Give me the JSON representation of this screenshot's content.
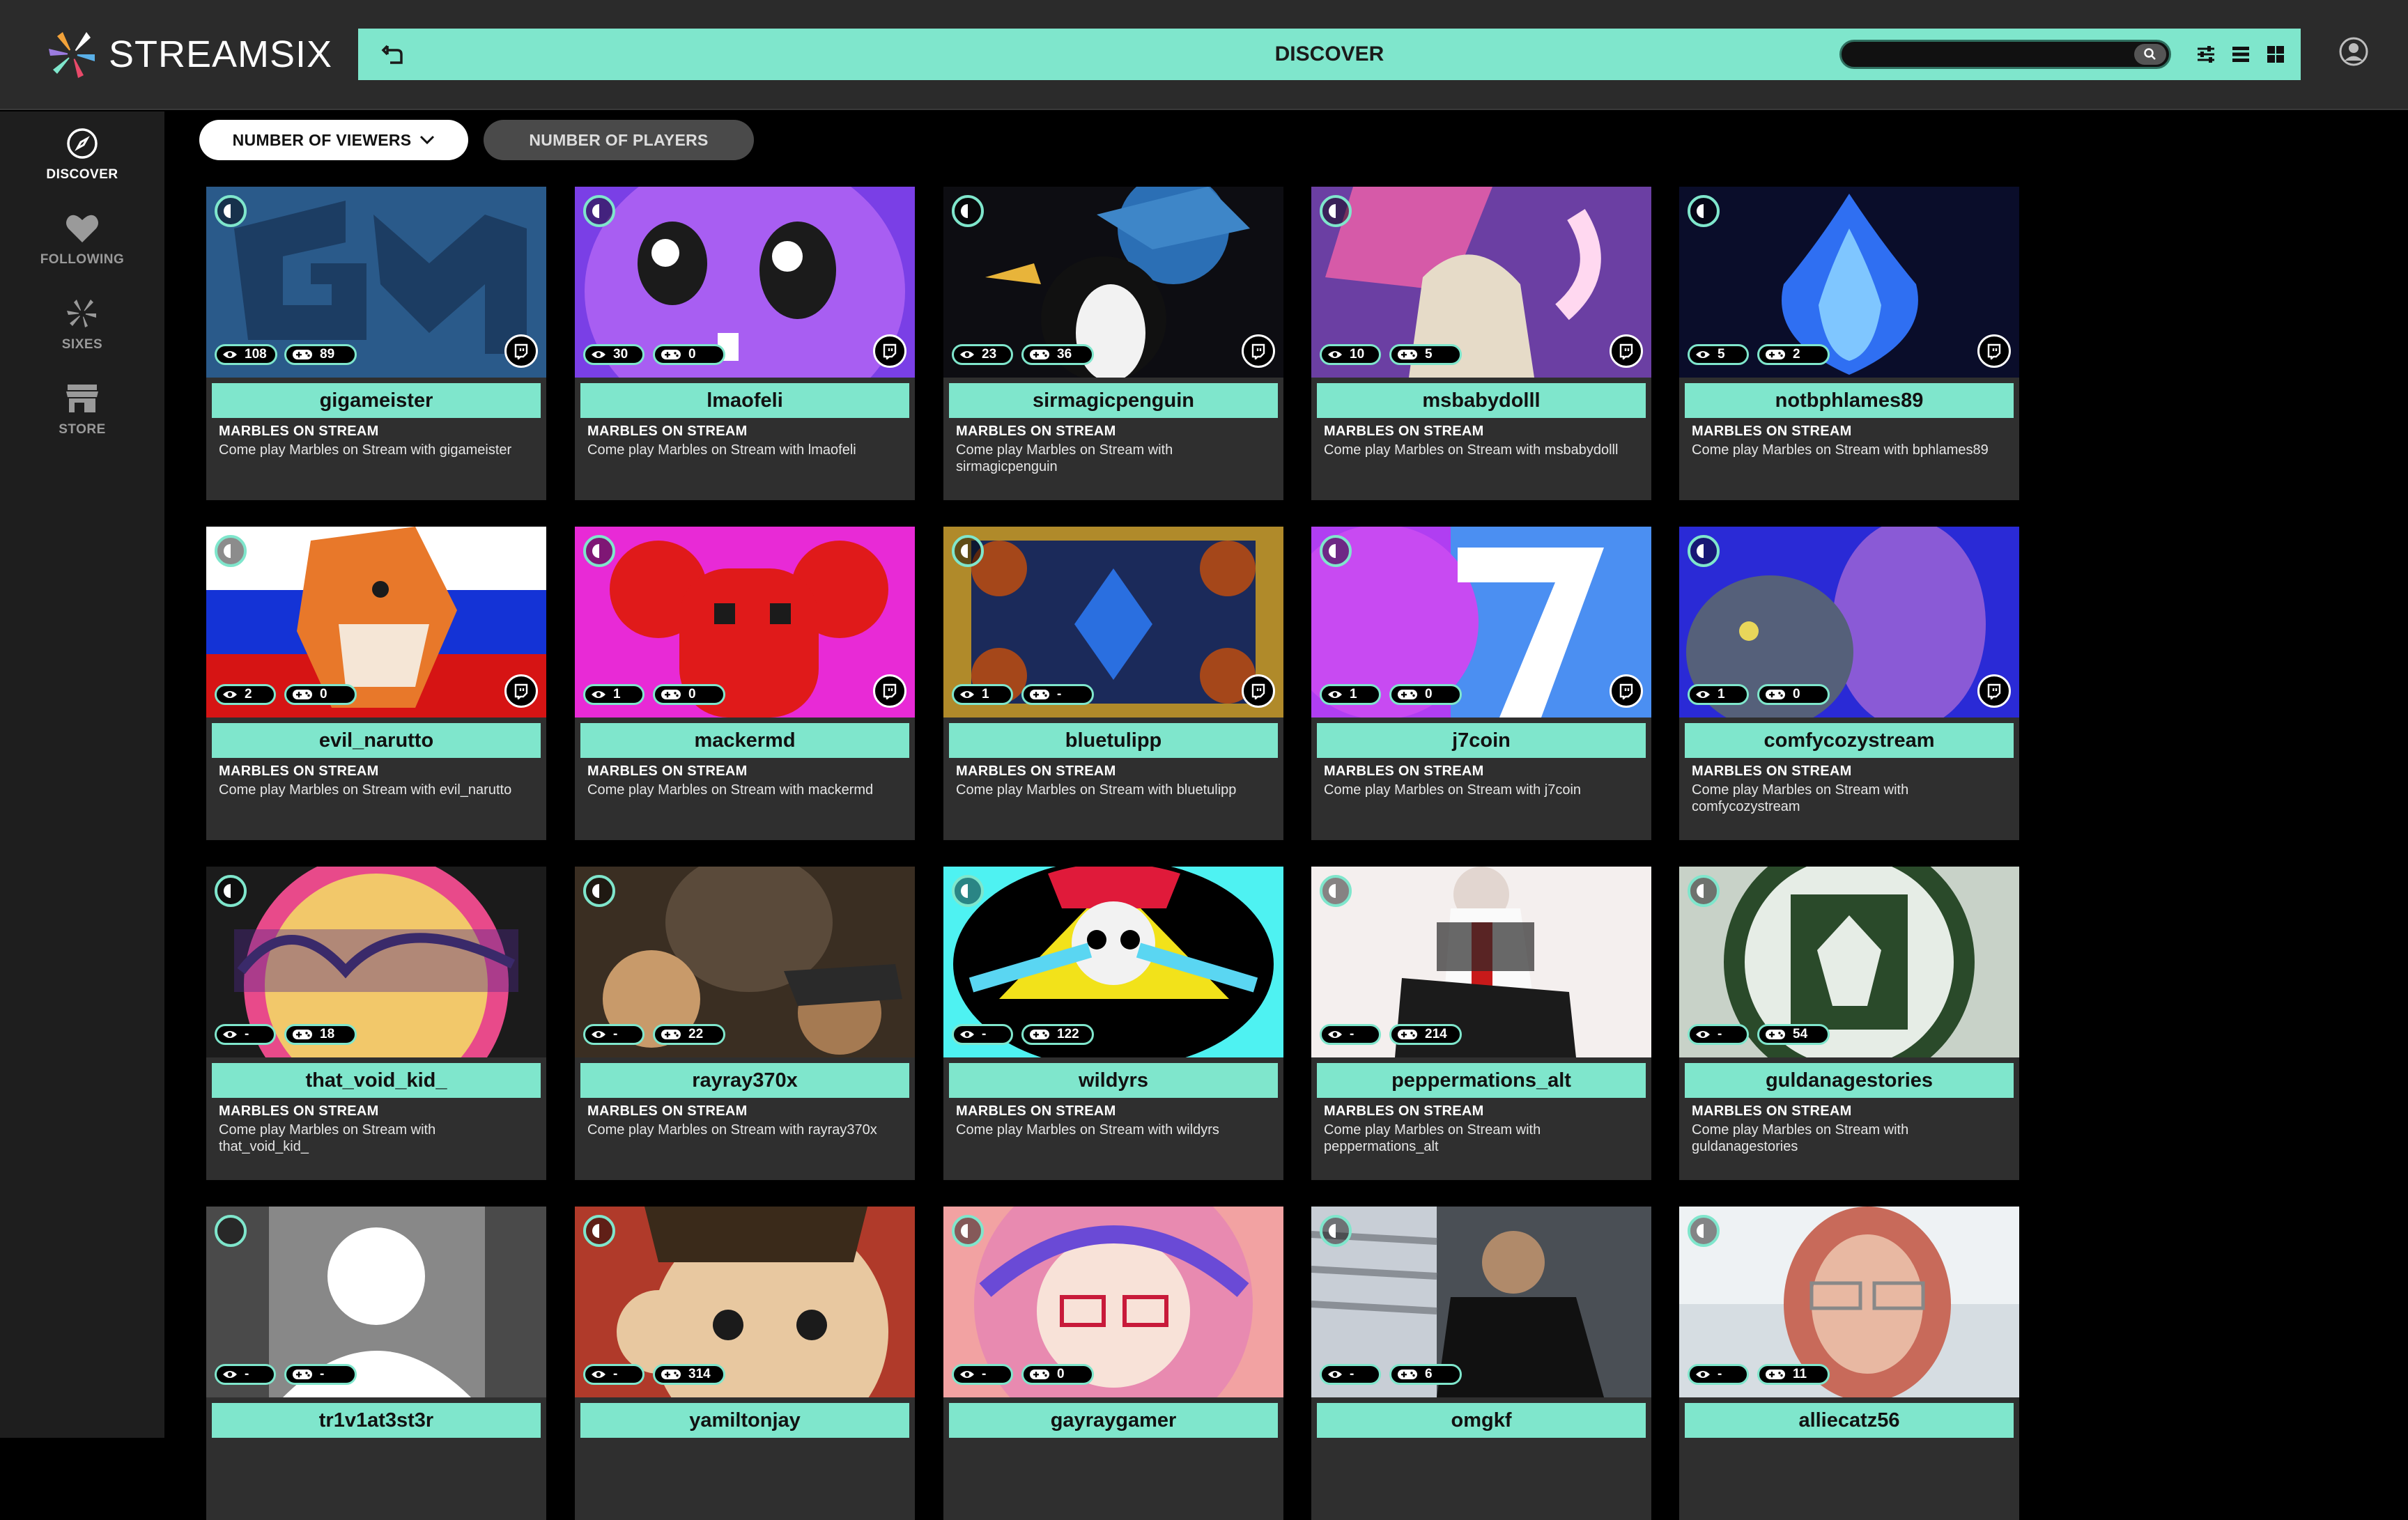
{
  "app": {
    "name": "STREAMSIX",
    "accent": "#7fe6cc"
  },
  "header": {
    "title": "DISCOVER",
    "search_value": "",
    "search_placeholder": "",
    "icons": [
      "back-icon",
      "search-icon",
      "filter-sliders-icon",
      "list-view-icon",
      "grid-view-icon",
      "profile-icon"
    ]
  },
  "sidebar": {
    "items": [
      {
        "label": "DISCOVER",
        "icon": "compass-icon",
        "active": true
      },
      {
        "label": "FOLLOWING",
        "icon": "heart-icon",
        "active": false
      },
      {
        "label": "SIXES",
        "icon": "sixes-icon",
        "active": false
      },
      {
        "label": "STORE",
        "icon": "store-icon",
        "active": false
      }
    ]
  },
  "filters": {
    "viewers_label": "NUMBER OF VIEWERS",
    "players_label": "NUMBER OF PLAYERS",
    "active": "viewers"
  },
  "cards": [
    {
      "name": "gigameister",
      "viewers": "108",
      "players": "89",
      "game": "MARBLES ON STREAM",
      "desc": "Come play Marbles on Stream with gigameister",
      "twitch": true,
      "live": true
    },
    {
      "name": "lmaofeli",
      "viewers": "30",
      "players": "0",
      "game": "MARBLES ON STREAM",
      "desc": "Come play Marbles on Stream with lmaofeli",
      "twitch": true,
      "live": true
    },
    {
      "name": "sirmagicpenguin",
      "viewers": "23",
      "players": "36",
      "game": "MARBLES ON STREAM",
      "desc": "Come play Marbles on Stream with sirmagicpenguin",
      "twitch": true,
      "live": true
    },
    {
      "name": "msbabydolll",
      "viewers": "10",
      "players": "5",
      "game": "MARBLES ON STREAM",
      "desc": "Come play Marbles on Stream with msbabydolll",
      "twitch": true,
      "live": true
    },
    {
      "name": "notbphlames89",
      "viewers": "5",
      "players": "2",
      "game": "MARBLES ON STREAM",
      "desc": "Come play Marbles on Stream with bphlames89",
      "twitch": true,
      "live": true
    },
    {
      "name": "evil_narutto",
      "viewers": "2",
      "players": "0",
      "game": "MARBLES ON STREAM",
      "desc": "Come play Marbles on Stream with evil_narutto",
      "twitch": true,
      "live": true
    },
    {
      "name": "mackermd",
      "viewers": "1",
      "players": "0",
      "game": "MARBLES ON STREAM",
      "desc": "Come play Marbles on Stream with mackermd",
      "twitch": true,
      "live": true
    },
    {
      "name": "bluetulipp",
      "viewers": "1",
      "players": "-",
      "game": "MARBLES ON STREAM",
      "desc": "Come play Marbles on Stream with bluetulipp",
      "twitch": true,
      "live": true
    },
    {
      "name": "j7coin",
      "viewers": "1",
      "players": "0",
      "game": "MARBLES ON STREAM",
      "desc": "Come play Marbles on Stream with j7coin",
      "twitch": true,
      "live": true
    },
    {
      "name": "comfycozystream",
      "viewers": "1",
      "players": "0",
      "game": "MARBLES ON STREAM",
      "desc": "Come play Marbles on Stream with comfycozystream",
      "twitch": true,
      "live": true
    },
    {
      "name": "that_void_kid_",
      "viewers": "-",
      "players": "18",
      "game": "MARBLES ON STREAM",
      "desc": "Come play Marbles on Stream with that_void_kid_",
      "twitch": false,
      "live": true
    },
    {
      "name": "rayray370x",
      "viewers": "-",
      "players": "22",
      "game": "MARBLES ON STREAM",
      "desc": "Come play Marbles on Stream with rayray370x",
      "twitch": false,
      "live": true
    },
    {
      "name": "wildyrs",
      "viewers": "-",
      "players": "122",
      "game": "MARBLES ON STREAM",
      "desc": "Come play Marbles on Stream with wildyrs",
      "twitch": false,
      "live": true
    },
    {
      "name": "peppermations_alt",
      "viewers": "-",
      "players": "214",
      "game": "MARBLES ON STREAM",
      "desc": "Come play Marbles on Stream with peppermations_alt",
      "twitch": false,
      "live": true
    },
    {
      "name": "guldanagestories",
      "viewers": "-",
      "players": "54",
      "game": "MARBLES ON STREAM",
      "desc": "Come play Marbles on Stream with guldanagestories",
      "twitch": false,
      "live": true
    },
    {
      "name": "tr1v1at3st3r",
      "viewers": "-",
      "players": "-",
      "game": "",
      "desc": "",
      "twitch": false,
      "live": false
    },
    {
      "name": "yamiltonjay",
      "viewers": "-",
      "players": "314",
      "game": "",
      "desc": "",
      "twitch": false,
      "live": true
    },
    {
      "name": "gayraygamer",
      "viewers": "-",
      "players": "0",
      "game": "",
      "desc": "",
      "twitch": false,
      "live": true
    },
    {
      "name": "omgkf",
      "viewers": "-",
      "players": "6",
      "game": "",
      "desc": "",
      "twitch": false,
      "live": true
    },
    {
      "name": "alliecatz56",
      "viewers": "-",
      "players": "11",
      "game": "",
      "desc": "",
      "twitch": false,
      "live": true
    }
  ]
}
